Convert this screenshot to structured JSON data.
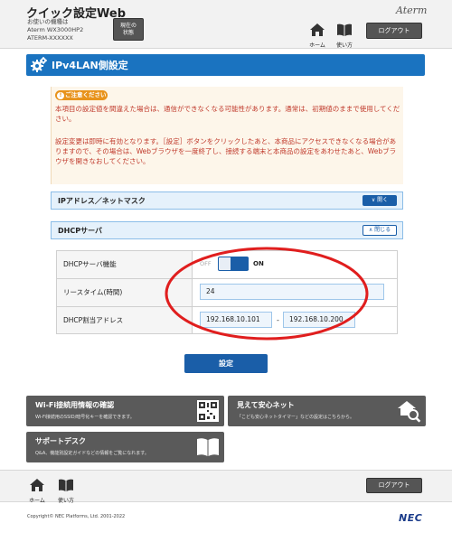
{
  "header": {
    "app_title": "クイック設定Web",
    "device_line1": "お使いの機種は",
    "device_line2": "Aterm WX3000HP2",
    "device_line3": "ATERM-XXXXXX",
    "status_line1": "現在の",
    "status_line2": "状態",
    "home_label": "ホーム",
    "manual_label": "使い方",
    "logout_label": "ログアウト",
    "brand": "Aterm"
  },
  "page": {
    "title": "IPv4LAN側設定"
  },
  "caution": {
    "badge": "ご注意ください",
    "paragraph1": "本項目の設定値を間違えた場合は、通信ができなくなる可能性があります。通常は、初期値のままで使用してください。",
    "paragraph2": "設定変更は即時に有効となります。［設定］ボタンをクリックしたあと、本商品にアクセスできなくなる場合がありますので、その場合は、Webブラウザを一度終了し、接続する端末と本商品の設定をあわせたあと、Webブラウザを開きなおしてください。"
  },
  "sections": {
    "ip_netmask": {
      "title": "IPアドレス／ネットマスク",
      "button": "開く"
    },
    "dhcp": {
      "title": "DHCPサーバ",
      "button": "閉じる"
    }
  },
  "dhcp": {
    "server_function_label": "DHCPサーバ機能",
    "toggle_off": "OFF",
    "toggle_on": "ON",
    "toggle_state": "on",
    "lease_time_label": "リースタイム(時間)",
    "lease_time_value": "24",
    "range_label": "DHCP割当アドレス",
    "range_start": "192.168.10.101",
    "range_separator": "-",
    "range_end": "192.168.10.200"
  },
  "actions": {
    "settings_label": "設定"
  },
  "cards": {
    "wifi": {
      "title": "Wi-Fi接続用情報の確認",
      "desc": "Wi-Fi接続用のSSID/暗号化キーを確認できます。",
      "icon": "qr-code-icon"
    },
    "safety": {
      "title": "見えて安心ネット",
      "desc": "「こども安心ネットタイマー」などの設定はこちらから。",
      "icon": "house-magnifier-icon"
    },
    "support": {
      "title": "サポートデスク",
      "desc": "Q&A、機能別設定ガイドなどの情報をご覧になれます。",
      "icon": "book-icon"
    }
  },
  "footer": {
    "home_label": "ホーム",
    "manual_label": "使い方",
    "logout_label": "ログアウト",
    "copyright": "Copyright© NEC Platforms, Ltd. 2001-2022",
    "brand": "NEC"
  },
  "colors": {
    "primary": "#1a73c0",
    "button_blue": "#1a5ea8",
    "caution_text": "#c0392b",
    "caution_badge": "#e8931c",
    "annotation": "#e01e1e"
  }
}
